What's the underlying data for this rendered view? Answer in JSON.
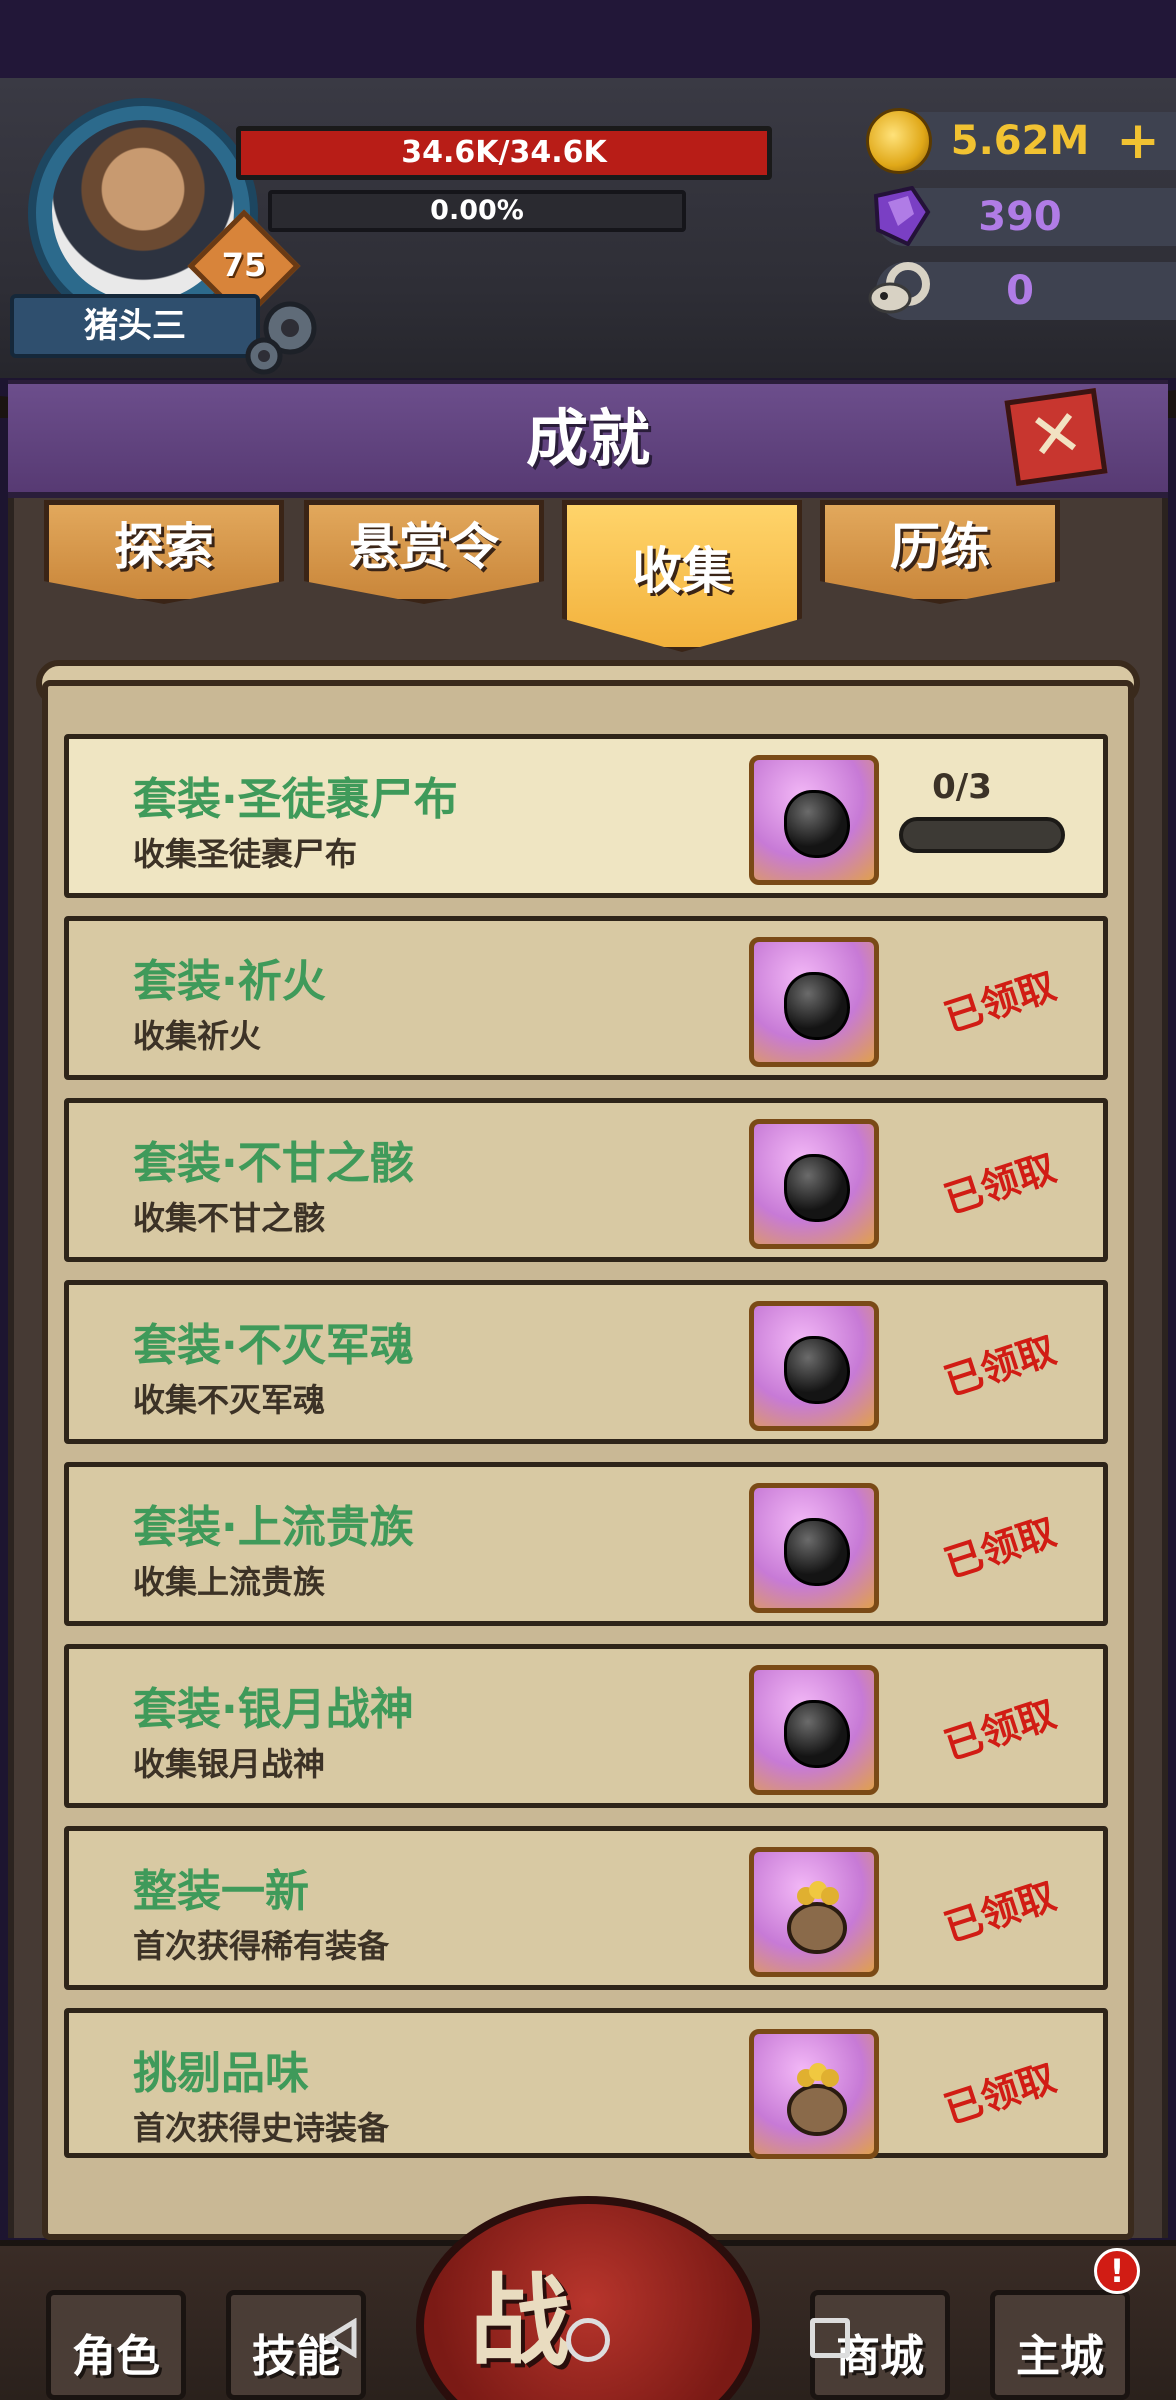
{
  "player": {
    "name": "猪头三",
    "level": "75",
    "hp_text": "34.6K/34.6K",
    "xp_text": "0.00%"
  },
  "resources": {
    "gold": "5.62M",
    "gems": "390",
    "skulls": "0",
    "gold_color": "#f1c232",
    "gem_color": "#b07ce6"
  },
  "panel": {
    "title": "成就",
    "close_label": "✕"
  },
  "tabs": [
    {
      "label": "探索",
      "active": false
    },
    {
      "label": "悬赏令",
      "active": false
    },
    {
      "label": "收集",
      "active": true
    },
    {
      "label": "历练",
      "active": false
    }
  ],
  "achievements": [
    {
      "title": "套装·圣徒裹尸布",
      "desc": "收集圣徒裹尸布",
      "reward_icon": "stone-icon",
      "progress": "0/3",
      "status": ""
    },
    {
      "title": "套装·祈火",
      "desc": "收集祈火",
      "reward_icon": "stone-icon",
      "progress": "",
      "status": "已领取"
    },
    {
      "title": "套装·不甘之骸",
      "desc": "收集不甘之骸",
      "reward_icon": "stone-icon",
      "progress": "",
      "status": "已领取"
    },
    {
      "title": "套装·不灭军魂",
      "desc": "收集不灭军魂",
      "reward_icon": "stone-icon",
      "progress": "",
      "status": "已领取"
    },
    {
      "title": "套装·上流贵族",
      "desc": "收集上流贵族",
      "reward_icon": "stone-icon",
      "progress": "",
      "status": "已领取"
    },
    {
      "title": "套装·银月战神",
      "desc": "收集银月战神",
      "reward_icon": "stone-icon",
      "progress": "",
      "status": "已领取"
    },
    {
      "title": "整装一新",
      "desc": "首次获得稀有装备",
      "reward_icon": "coin-bag-icon",
      "progress": "",
      "status": "已领取"
    },
    {
      "title": "挑剔品味",
      "desc": "首次获得史诗装备",
      "reward_icon": "coin-bag-icon",
      "progress": "",
      "status": "已领取"
    }
  ],
  "nav": {
    "character": "角色",
    "skills": "技能",
    "battle": "战斗",
    "shop": "商城",
    "city": "主城",
    "city_badge": "!"
  },
  "colors": {
    "title_green": "#3f9a5a",
    "claimed_red": "#d11c14",
    "header_purple": "#6c4e8c"
  }
}
